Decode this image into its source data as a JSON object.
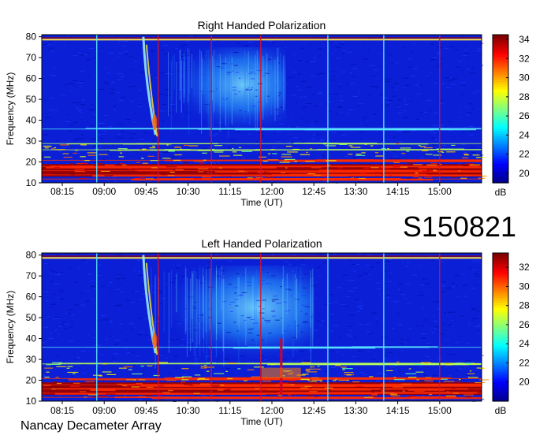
{
  "figure": {
    "event_label": "S150821",
    "instrument_label": "Nancay Decameter Array"
  },
  "colors": {
    "background": "#ffffff",
    "colormap": [
      "#00008f",
      "#0000ff",
      "#0080ff",
      "#00ffff",
      "#80ff80",
      "#ffff00",
      "#ff8000",
      "#ff0000",
      "#800000"
    ]
  },
  "chart_data": [
    {
      "type": "heatmap",
      "title": "Right Handed Polarization",
      "xlabel": "Time (UT)",
      "ylabel": "Frequency (MHz)",
      "xlim": [
        "07:53",
        "15:45"
      ],
      "ylim": [
        10,
        81
      ],
      "x_ticks": [
        "08:15",
        "09:00",
        "09:45",
        "10:30",
        "11:15",
        "12:00",
        "12:45",
        "13:30",
        "14:15",
        "15:00"
      ],
      "y_ticks": [
        10,
        20,
        30,
        40,
        50,
        60,
        70,
        80
      ],
      "colorbar": {
        "label": "dB",
        "range": [
          19,
          34.5
        ],
        "ticks": [
          20,
          22,
          24,
          26,
          28,
          30,
          32,
          34
        ]
      },
      "features": {
        "vertical_markers": [
          {
            "time": "08:52",
            "color": "cyan"
          },
          {
            "time": "09:58",
            "color": "red"
          },
          {
            "time": "10:55",
            "color": "red"
          },
          {
            "time": "11:48",
            "color": "red"
          },
          {
            "time": "13:00",
            "color": "cyan"
          },
          {
            "time": "14:00",
            "color": "cyan"
          },
          {
            "time": "15:00",
            "color": "red"
          }
        ],
        "drifting_burst": {
          "start_time": "09:42",
          "end_time": "09:55",
          "freq_high": 80,
          "freq_low": 33
        },
        "diffuse_emission": {
          "start_time": "10:05",
          "end_time": "12:15",
          "freq_low": 35,
          "freq_high": 75
        },
        "rfi_bands_mhz": [
          36,
          29,
          26,
          21,
          18,
          16,
          14,
          12
        ],
        "top_band_mhz": 79
      }
    },
    {
      "type": "heatmap",
      "title": "Left Handed Polarization",
      "xlabel": "Time (UT)",
      "ylabel": "Frequency (MHz)",
      "xlim": [
        "07:53",
        "15:45"
      ],
      "ylim": [
        10,
        81
      ],
      "x_ticks": [
        "08:15",
        "09:00",
        "09:45",
        "10:30",
        "11:15",
        "12:00",
        "12:45",
        "13:30",
        "14:15",
        "15:00"
      ],
      "y_ticks": [
        10,
        20,
        30,
        40,
        50,
        60,
        70,
        80
      ],
      "colorbar": {
        "label": "dB",
        "range": [
          18,
          33.5
        ],
        "ticks": [
          20,
          22,
          24,
          26,
          28,
          30,
          32
        ]
      },
      "features": {
        "vertical_markers": [
          {
            "time": "08:52",
            "color": "cyan"
          },
          {
            "time": "09:58",
            "color": "red"
          },
          {
            "time": "10:55",
            "color": "red"
          },
          {
            "time": "11:48",
            "color": "red"
          },
          {
            "time": "13:00",
            "color": "cyan"
          },
          {
            "time": "14:00",
            "color": "cyan"
          },
          {
            "time": "15:00",
            "color": "red"
          }
        ],
        "drifting_burst": {
          "start_time": "09:42",
          "end_time": "09:55",
          "freq_high": 80,
          "freq_low": 33
        },
        "diffuse_emission": {
          "start_time": "09:50",
          "end_time": "12:45",
          "freq_low": 30,
          "freq_high": 75
        },
        "rfi_bands_mhz": [
          36,
          28,
          21,
          18,
          16,
          14,
          12
        ],
        "narrow_spike": {
          "time": "12:10",
          "freq_low": 13,
          "freq_high": 40
        },
        "top_band_mhz": 79
      }
    }
  ]
}
